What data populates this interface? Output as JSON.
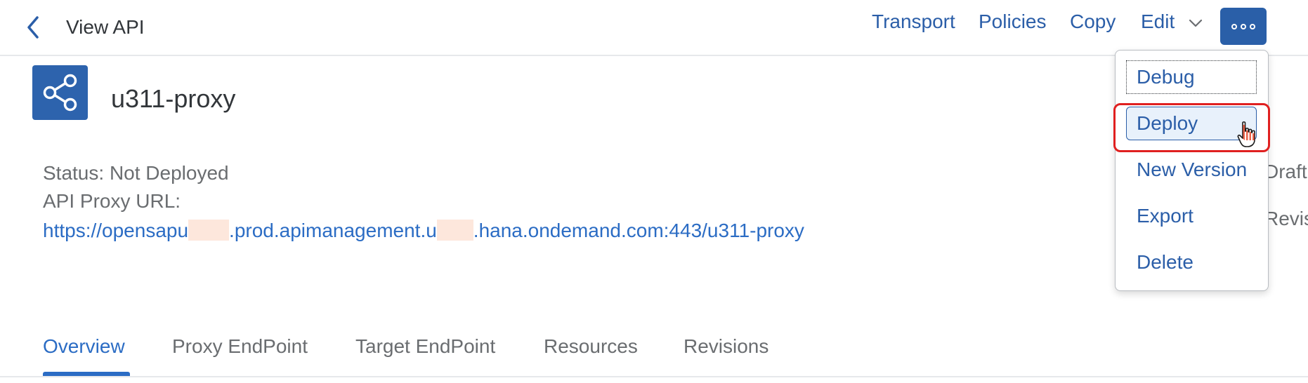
{
  "header": {
    "back_icon": "chevron-left-icon",
    "title": "View API",
    "actions": {
      "transport": "Transport",
      "policies": "Policies",
      "copy": "Copy",
      "edit": "Edit"
    },
    "more_icon": "overflow-icon"
  },
  "api": {
    "icon": "share-icon",
    "name": "u311-proxy",
    "status": "Status: Not Deployed",
    "url_label": "API Proxy URL:",
    "url_part1": "https://opensapu",
    "url_part2": ".prod.apimanagement.u",
    "url_part3": ".hana.ondemand.com:443/u311-proxy",
    "side_text_1": "Draft",
    "side_text_2": "Revis"
  },
  "tabs": [
    {
      "label": "Overview",
      "active": true
    },
    {
      "label": "Proxy EndPoint",
      "active": false
    },
    {
      "label": "Target EndPoint",
      "active": false
    },
    {
      "label": "Resources",
      "active": false
    },
    {
      "label": "Revisions",
      "active": false
    }
  ],
  "menu": {
    "items": [
      {
        "label": "Debug"
      },
      {
        "label": "Deploy"
      },
      {
        "label": "New Version"
      },
      {
        "label": "Export"
      },
      {
        "label": "Delete"
      }
    ]
  },
  "colors": {
    "accent": "#2b6cc4",
    "button_bg": "#2a5fa8",
    "highlight": "#e02020",
    "redaction": "#fde7dc"
  }
}
